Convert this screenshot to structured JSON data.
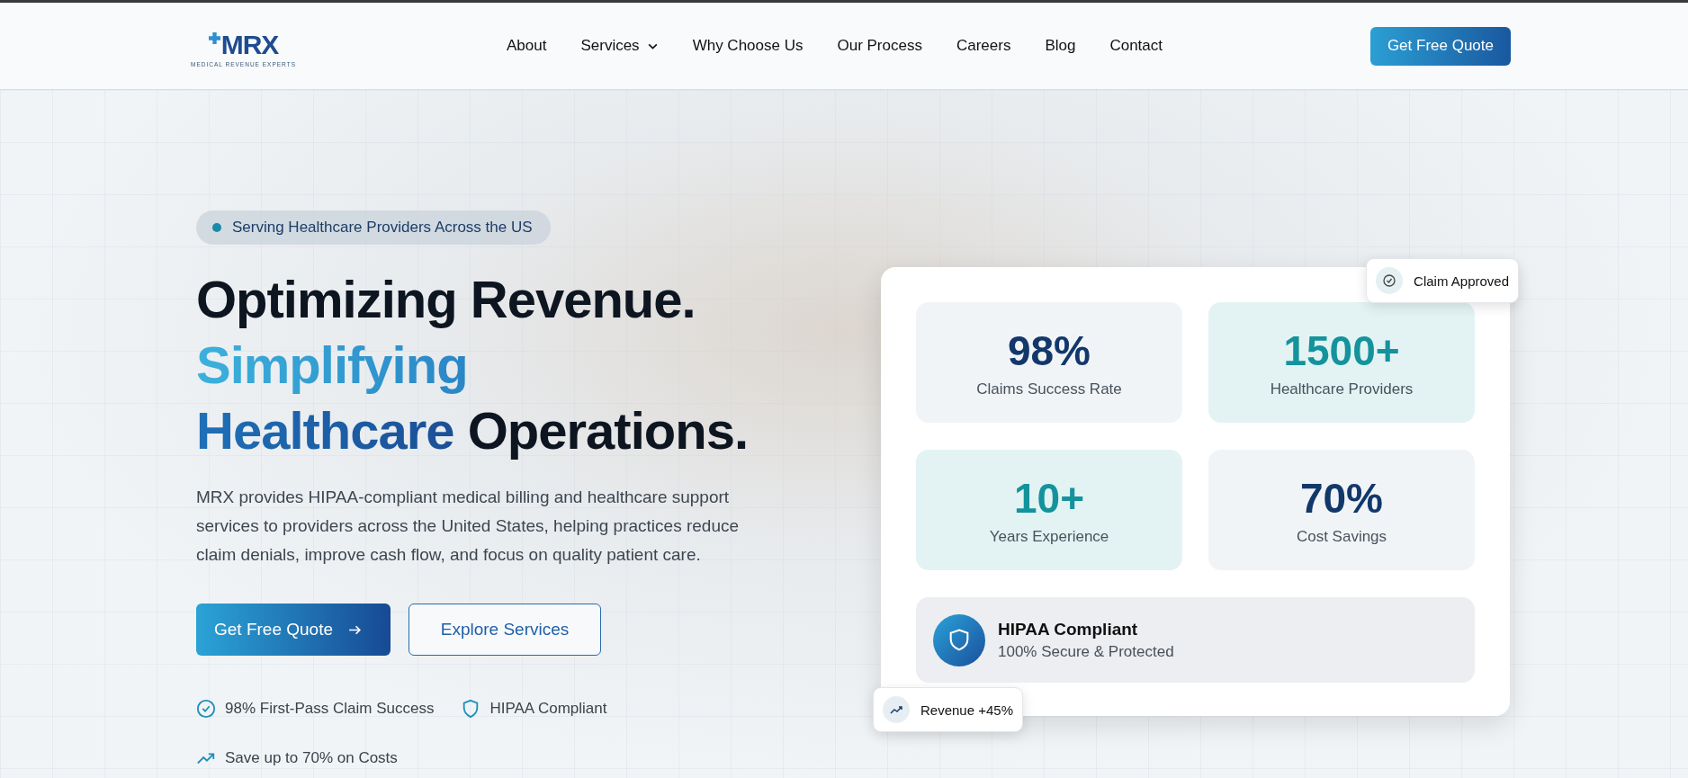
{
  "header": {
    "logo": {
      "name": "MRX",
      "tagline": "MEDICAL REVENUE EXPERTS"
    },
    "nav": [
      {
        "label": "About",
        "has_dropdown": false
      },
      {
        "label": "Services",
        "has_dropdown": true
      },
      {
        "label": "Why Choose Us",
        "has_dropdown": false
      },
      {
        "label": "Our Process",
        "has_dropdown": false
      },
      {
        "label": "Careers",
        "has_dropdown": false
      },
      {
        "label": "Blog",
        "has_dropdown": false
      },
      {
        "label": "Contact",
        "has_dropdown": false
      }
    ],
    "cta": "Get Free Quote"
  },
  "hero": {
    "badge": "Serving Healthcare Providers Across the US",
    "headline": [
      [
        {
          "text": "Optimizing Revenue.",
          "kind": "plain"
        }
      ],
      [
        {
          "text": "Simplifying",
          "kind": "light-gradient"
        }
      ],
      [
        {
          "text": "Healthcare",
          "kind": "dark-gradient"
        },
        {
          "text": " Operations.",
          "kind": "plain"
        }
      ]
    ],
    "description": "MRX provides HIPAA-compliant medical billing and healthcare support services to providers across the United States, helping practices reduce claim denials, improve cash flow, and focus on quality patient care.",
    "buttons": [
      {
        "label": "Get Free Quote",
        "kind": "primary"
      },
      {
        "label": "Explore Services",
        "kind": "outline"
      }
    ],
    "features": [
      {
        "text": "98% First-Pass Claim Success",
        "kind": "check"
      },
      {
        "text": "HIPAA Compliant",
        "kind": "shield"
      },
      {
        "text": "Save up to 70% on Costs",
        "kind": "trend"
      }
    ]
  },
  "stats_card": {
    "stats": [
      {
        "value": "98%",
        "label": "Claims Success Rate",
        "kind": "navy"
      },
      {
        "value": "1500+",
        "label": "Healthcare Providers",
        "kind": "teal"
      },
      {
        "value": "10+",
        "label": "Years Experience",
        "kind": "teal"
      },
      {
        "value": "70%",
        "label": "Cost Savings",
        "kind": "navy"
      }
    ],
    "compliance": {
      "title": "HIPAA Compliant",
      "subtitle": "100% Secure & Protected"
    },
    "toasts": [
      {
        "text": "Claim Approved",
        "kind": "check"
      },
      {
        "text": "Revenue +45%",
        "kind": "trend"
      }
    ]
  }
}
